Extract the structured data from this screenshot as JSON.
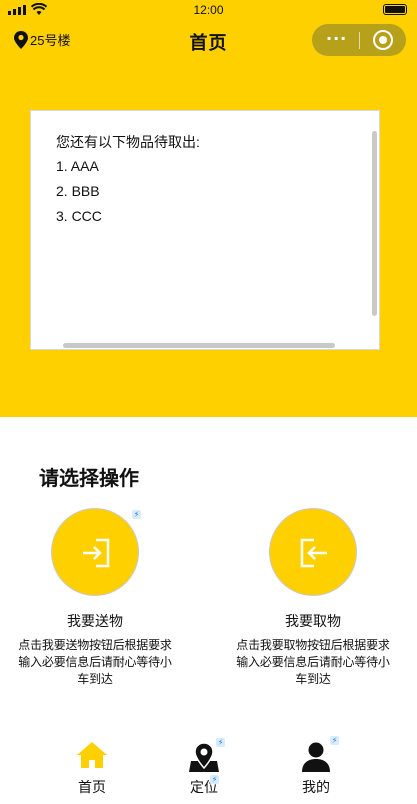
{
  "status_bar": {
    "time": "12:00"
  },
  "navbar": {
    "location": "25号楼",
    "title": "首页",
    "more_label": "···"
  },
  "notice": {
    "heading": "您还有以下物品待取出:",
    "items": [
      "1. AAA",
      "2. BBB",
      "3. CCC"
    ]
  },
  "section_title": "请选择操作",
  "actions": [
    {
      "label": "我要送物",
      "desc": "点击我要送物按钮后根据要求输入必要信息后请耐心等待小车到达",
      "icon": "login-arrow-icon"
    },
    {
      "label": "我要取物",
      "desc": "点击我要取物按钮后根据要求输入必要信息后请耐心等待小车到达",
      "icon": "logout-arrow-icon"
    }
  ],
  "tabbar": [
    {
      "label": "首页",
      "icon": "home-icon",
      "active": true
    },
    {
      "label": "定位",
      "icon": "map-pin-icon",
      "active": false
    },
    {
      "label": "我的",
      "icon": "user-icon",
      "active": false
    }
  ],
  "colors": {
    "accent": "#ffd000",
    "capsule": "#b8a11a",
    "text": "#111111"
  }
}
